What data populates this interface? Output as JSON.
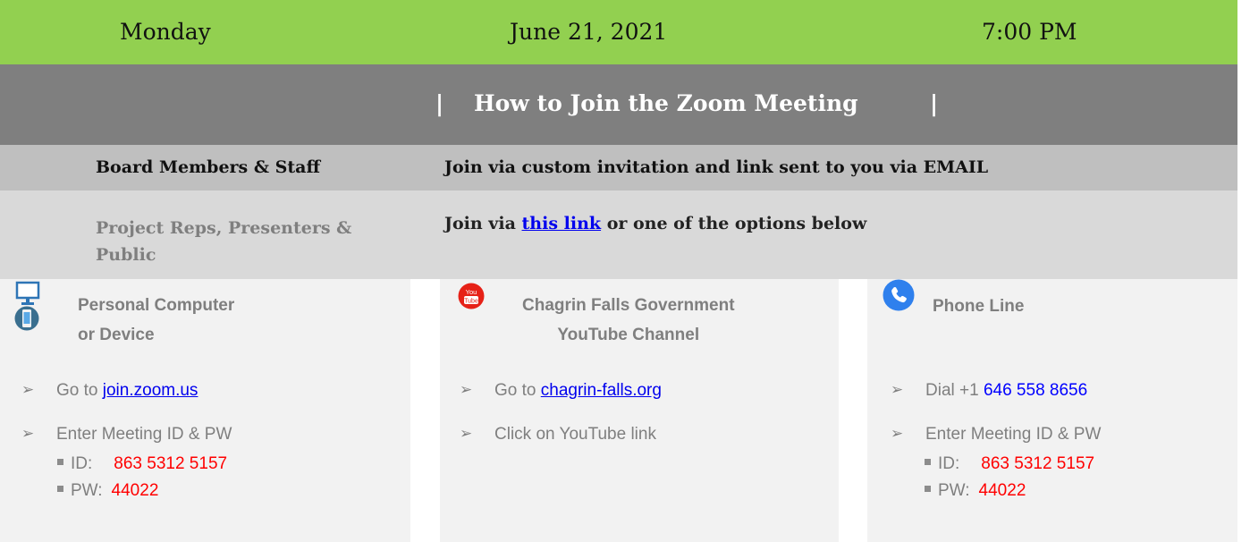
{
  "header": {
    "day": "Monday",
    "date": "June 21, 2021",
    "time": "7:00 PM",
    "title": "How to Join the Zoom Meeting",
    "pipe": "|"
  },
  "board": {
    "who": "Board Members & Staff",
    "how": "Join via custom invitation and link sent to you via EMAIL"
  },
  "public": {
    "who": "Project Reps, Presenters & Public",
    "join_prefix": "Join via",
    "join_link": "this link",
    "join_suffix": "or one of the options below"
  },
  "columns": {
    "computer": {
      "heading_line1": "Personal Computer",
      "heading_line2": "or Device",
      "step1_prefix": "Go to",
      "step1_link": "join.zoom.us",
      "step2": "Enter Meeting ID & PW",
      "id_label": "ID:",
      "id_value": "863 5312 5157",
      "pw_label": "PW:",
      "pw_value": "44022"
    },
    "youtube": {
      "heading_line1": "Chagrin Falls Government",
      "heading_line2": "YouTube Channel",
      "icon_text_1": "You",
      "icon_text_2": "Tube",
      "step1_prefix": "Go to",
      "step1_link": "chagrin-falls.org",
      "step2": "Click on YouTube link"
    },
    "phone": {
      "heading": "Phone Line",
      "step1_prefix": "Dial +1",
      "step1_number": "646 558 8656",
      "step2": "Enter Meeting ID & PW",
      "id_label": "ID:",
      "id_value": "863 5312 5157",
      "pw_label": "PW:",
      "pw_value": "44022"
    }
  },
  "colors": {
    "date_bar": "#92d050",
    "title_bar": "#7f7f7f",
    "board_row": "#bfbfbf",
    "public_row": "#d9d9d9",
    "column_bg": "#f2f2f2",
    "highlight_red": "#ff0000",
    "phone_blue": "#0000ff"
  },
  "icons": [
    "monitor-icon",
    "smartphone-icon",
    "youtube-icon",
    "phone-icon",
    "arrow-bullet-icon",
    "square-bullet-icon"
  ]
}
